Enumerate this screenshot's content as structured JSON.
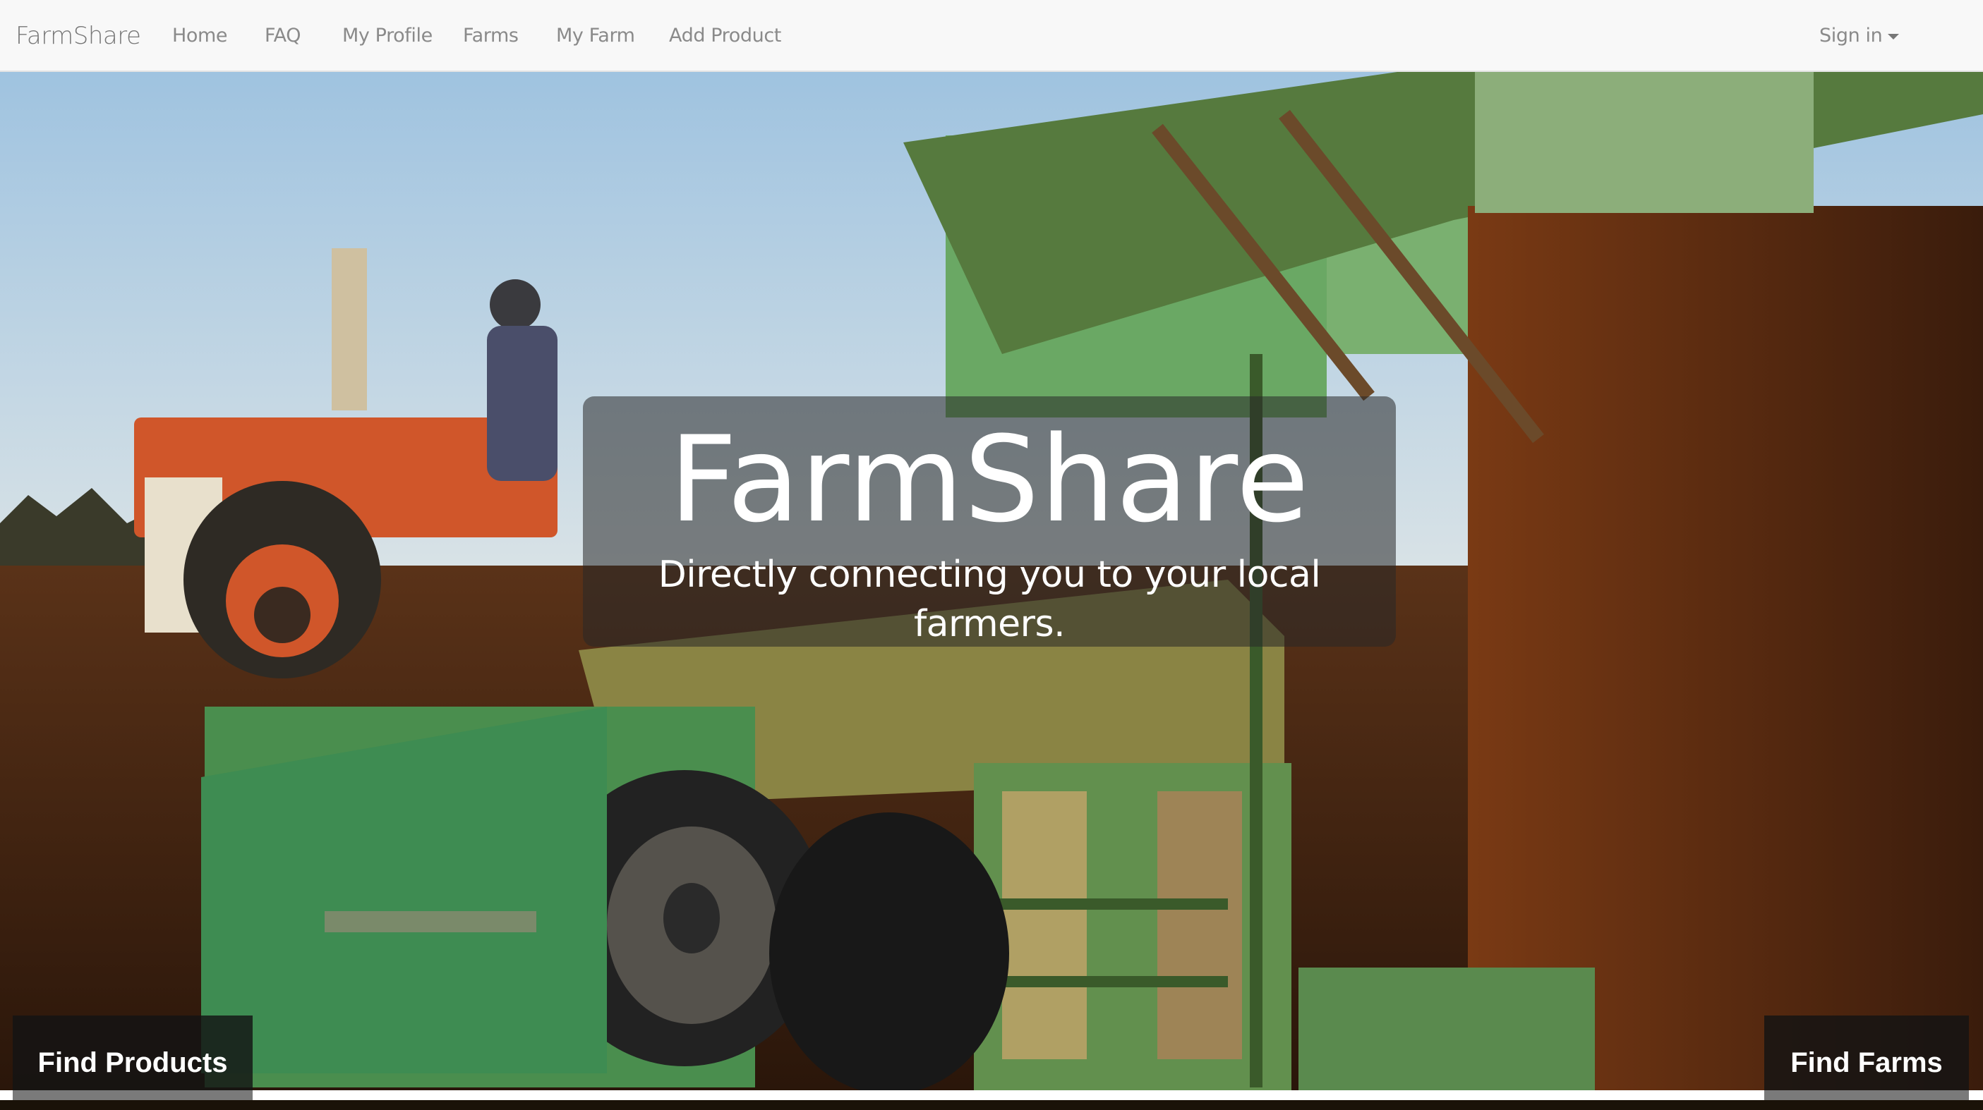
{
  "navbar": {
    "brand": "FarmShare",
    "links": [
      "Home",
      "FAQ",
      "My Profile",
      "Farms",
      "My Farm",
      "Add Product"
    ],
    "signin_label": "Sign in",
    "signin_icon": "caret-down-icon"
  },
  "hero": {
    "title": "FarmShare",
    "tagline": "Directly connecting you to your local farmers.",
    "background_image": "tractor-farm-photo"
  },
  "actions": {
    "find_products": "Find Products",
    "find_farms": "Find Farms"
  }
}
